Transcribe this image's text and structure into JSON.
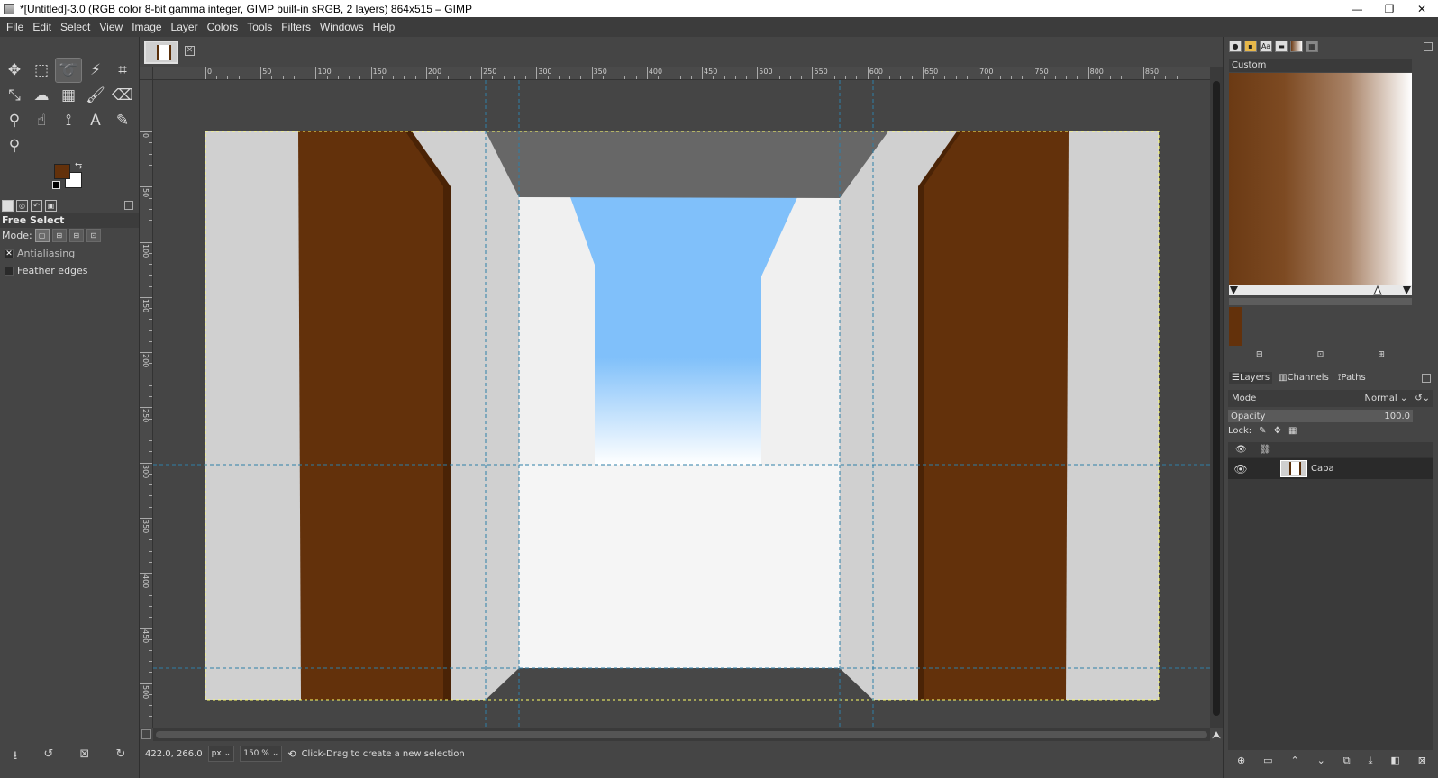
{
  "window": {
    "title": "*[Untitled]-3.0 (RGB color 8-bit gamma integer, GIMP built-in sRGB, 2 layers) 864x515 – GIMP",
    "minimize": "—",
    "maximize": "❐",
    "close": "✕"
  },
  "menu": [
    "File",
    "Edit",
    "Select",
    "View",
    "Image",
    "Layer",
    "Colors",
    "Tools",
    "Filters",
    "Windows",
    "Help"
  ],
  "toolbox": {
    "tools": [
      {
        "name": "move-tool",
        "glyph": "✥"
      },
      {
        "name": "rect-select-tool",
        "glyph": "⬚"
      },
      {
        "name": "free-select-tool",
        "glyph": "➰",
        "active": true
      },
      {
        "name": "fuzzy-select-tool",
        "glyph": "⚡"
      },
      {
        "name": "crop-tool",
        "glyph": "⌗"
      },
      {
        "name": "transform-tool",
        "glyph": "⤡"
      },
      {
        "name": "warp-tool",
        "glyph": "☁"
      },
      {
        "name": "gradient-tool",
        "glyph": "▦"
      },
      {
        "name": "paintbrush-tool",
        "glyph": "🖌"
      },
      {
        "name": "eraser-tool",
        "glyph": "⌫"
      },
      {
        "name": "clone-tool",
        "glyph": "⚲"
      },
      {
        "name": "smudge-tool",
        "glyph": "☝"
      },
      {
        "name": "paths-tool",
        "glyph": "⟟"
      },
      {
        "name": "text-tool",
        "glyph": "A"
      },
      {
        "name": "color-picker-tool",
        "glyph": "✎"
      },
      {
        "name": "zoom-tool",
        "glyph": "⚲"
      }
    ],
    "fg_color": "#63310b",
    "bg_color": "#ffffff",
    "options_title": "Free Select",
    "mode_label": "Mode:",
    "antialiasing": "Antialiasing",
    "feather_edges": "Feather edges"
  },
  "ruler": {
    "h_labels": [
      "0",
      "50",
      "100",
      "150",
      "200",
      "250",
      "300",
      "350",
      "400",
      "450",
      "500",
      "550",
      "600",
      "650",
      "700",
      "750",
      "800",
      "850"
    ],
    "v_labels": [
      "0",
      "50",
      "100",
      "150",
      "200",
      "250",
      "300",
      "350",
      "400",
      "450",
      "500"
    ]
  },
  "image": {
    "wall_color": "#d0d0d0",
    "door_color": "#63310b",
    "door_edge_color": "#4a2306",
    "ceiling_color": "#676767",
    "floor_color": "#474747",
    "inner_wall_color": "#f0f0f0",
    "floor_light": "#f5f5f5",
    "sky_top": "#80c0fa",
    "sky_bottom": "#ffffff",
    "guide_color": "#2e7fa8"
  },
  "status": {
    "coords": "422.0, 266.0",
    "unit": "px",
    "zoom": "150 %",
    "message": "Click-Drag to create a new selection"
  },
  "dock": {
    "gradient_name": "Custom",
    "grad_fg": "#63310b",
    "tabs": [
      "Layers",
      "Channels",
      "Paths"
    ],
    "mode_label": "Mode",
    "mode_value": "Normal",
    "opacity_label": "Opacity",
    "opacity_value": "100.0",
    "lock_label": "Lock:",
    "layer_name": "Capa"
  }
}
